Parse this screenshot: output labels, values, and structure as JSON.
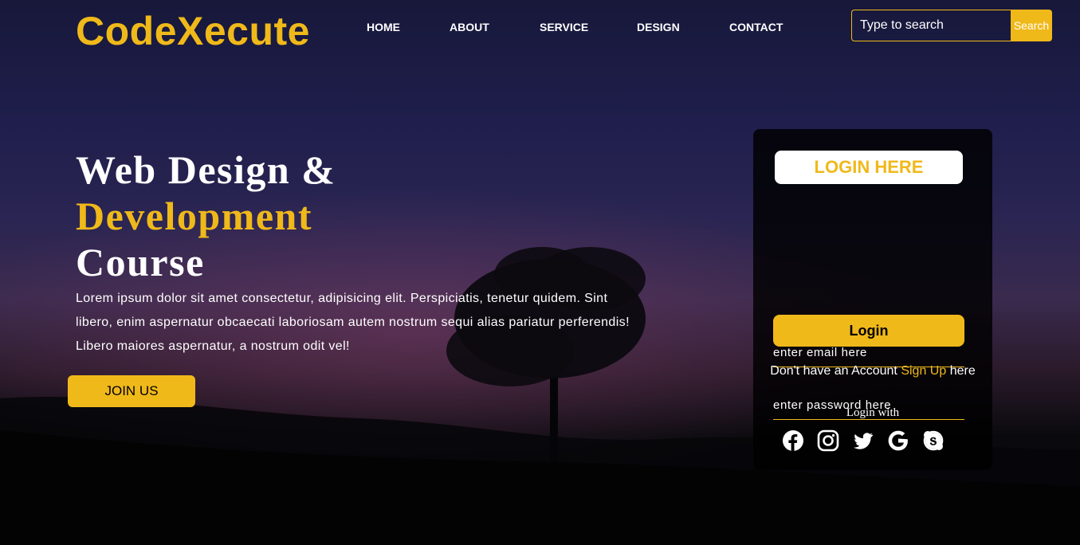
{
  "brand": {
    "logo": "CodeXecute"
  },
  "nav": {
    "items": [
      {
        "label": "HOME"
      },
      {
        "label": "ABOUT"
      },
      {
        "label": "SERVICE"
      },
      {
        "label": "DESIGN"
      },
      {
        "label": "CONTACT"
      }
    ]
  },
  "search": {
    "placeholder": "Type to search",
    "button_label": "Search"
  },
  "hero": {
    "title_line1": "Web Design &",
    "title_line2": "Development",
    "title_line3": "Course",
    "body": "Lorem ipsum dolor sit amet consectetur, adipisicing elit. Perspiciatis, tenetur quidem. Sint libero, enim aspernatur obcaecati laboriosam autem nostrum sequi alias pariatur perferendis! Libero maiores aspernatur, a nostrum odit vel!",
    "cta_label": "JOIN US"
  },
  "login": {
    "title": "LOGIN HERE",
    "email_placeholder": "enter email here",
    "password_placeholder": "enter password here",
    "button_label": "Login",
    "signup_prefix": "Don't have an Account ",
    "signup_link": "Sign Up",
    "signup_suffix": " here",
    "login_with": "Login with",
    "socials": [
      "facebook-icon",
      "instagram-icon",
      "twitter-icon",
      "google-icon",
      "skype-icon"
    ]
  },
  "colors": {
    "accent": "#f0b91a",
    "text": "#ffffff",
    "panel": "#000000"
  }
}
